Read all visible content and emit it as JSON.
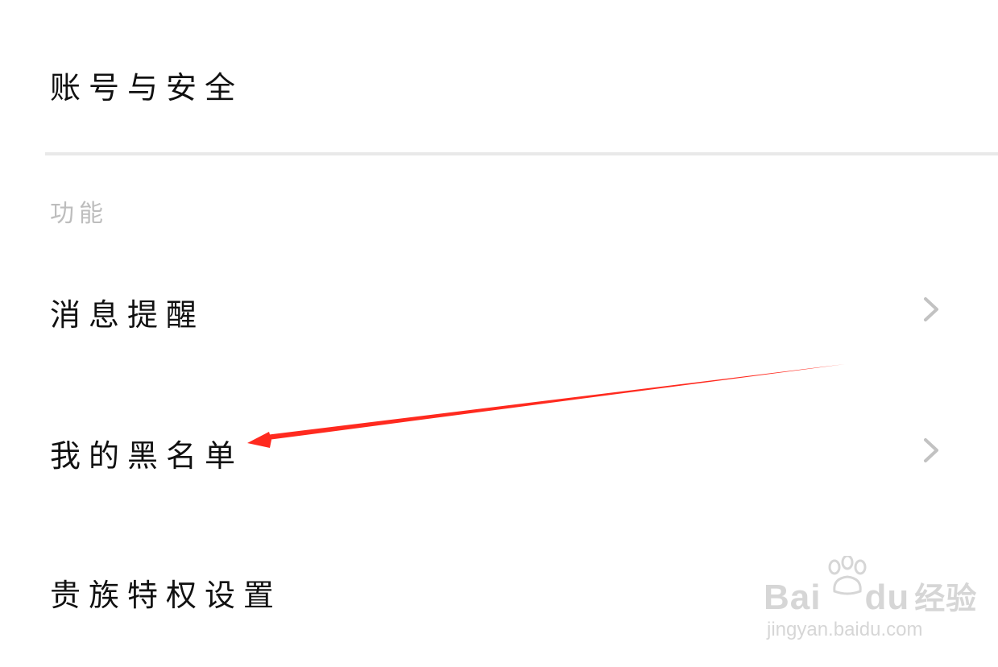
{
  "settings": {
    "account_label": "账号与安全",
    "section_title": "功能",
    "items": [
      {
        "label": "消息提醒"
      },
      {
        "label": "我的黑名单"
      },
      {
        "label": "贵族特权设置"
      }
    ]
  },
  "annotation": {
    "arrow_color": "#ff2a1f",
    "icon": "red-arrow"
  },
  "watermark": {
    "brand": "Bai",
    "brand_suffix": "du",
    "brand_cn": "经验",
    "url": "jingyan.baidu.com"
  },
  "colors": {
    "text": "#111111",
    "section_text": "#bdbdbd",
    "divider": "#e9e9e9",
    "chevron": "#c2c2c2"
  }
}
